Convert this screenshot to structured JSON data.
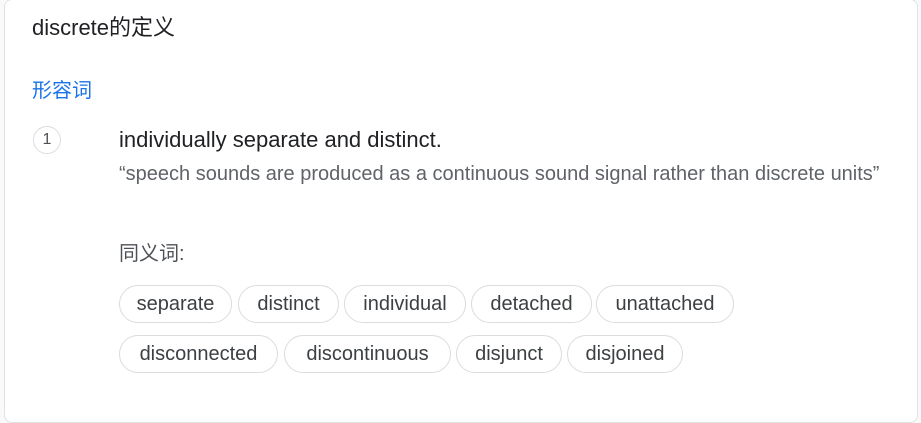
{
  "title": "discrete的定义",
  "part_of_speech": "形容词",
  "sense": {
    "number": "1",
    "definition": "individually separate and distinct.",
    "example": "“speech sounds are produced as a continuous sound signal rather than discrete units”"
  },
  "synonyms": {
    "label": "同义词:",
    "items": [
      "separate",
      "distinct",
      "individual",
      "detached",
      "unattached",
      "disconnected",
      "discontinuous",
      "disjunct",
      "disjoined"
    ]
  }
}
